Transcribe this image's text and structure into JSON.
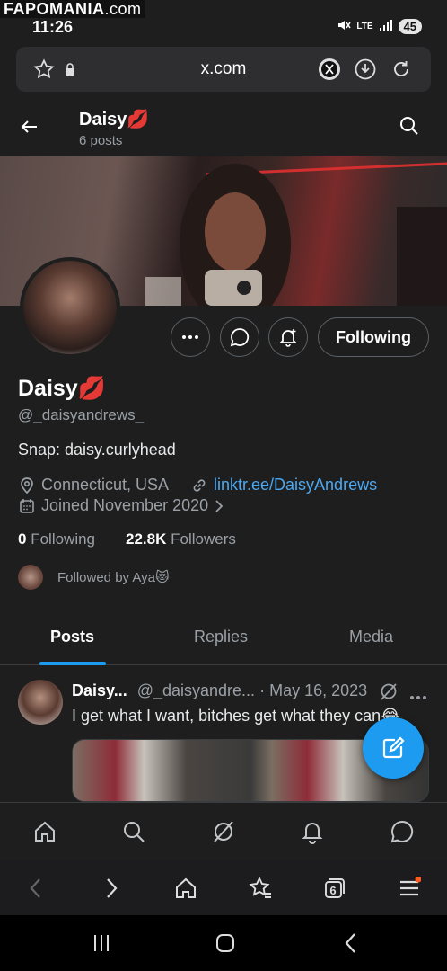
{
  "watermark": {
    "brand": "FAPOMANIA",
    "suffix": ".com"
  },
  "status_bar": {
    "time": "11:26",
    "network": "LTE",
    "battery": "45"
  },
  "browser": {
    "url": "x.com",
    "tab_count": "6"
  },
  "header": {
    "name": "Daisy💋",
    "posts": "6 posts"
  },
  "profile": {
    "name": "Daisy💋",
    "handle": "@_daisyandrews_",
    "bio": "Snap: daisy.curlyhead",
    "location": "Connecticut, USA",
    "link": "linktr.ee/DaisyAndrews",
    "joined": "Joined November 2020",
    "following_count": "0",
    "following_label": "Following",
    "followers_count": "22.8K",
    "followers_label": "Followers",
    "followed_by": "Followed by Aya😻",
    "follow_button": "Following"
  },
  "tabs": [
    {
      "label": "Posts",
      "active": true
    },
    {
      "label": "Replies",
      "active": false
    },
    {
      "label": "Media",
      "active": false
    }
  ],
  "tweet": {
    "name": "Daisy...",
    "handle": "@_daisyandre...",
    "date": "· May 16, 2023",
    "text": "I get what I want, bitches get what they can😂"
  },
  "colors": {
    "accent": "#1d9bf0",
    "link": "#4ea8f0",
    "background": "#1e1e1e"
  }
}
